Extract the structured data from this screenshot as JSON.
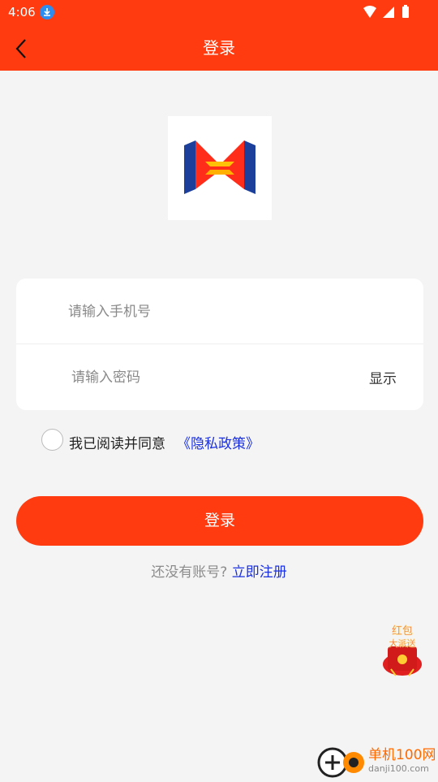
{
  "status": {
    "time": "4:06"
  },
  "header": {
    "title": "登录"
  },
  "form": {
    "phone_placeholder": "请输入手机号",
    "password_placeholder": "请输入密码",
    "show_label": "显示"
  },
  "agreement": {
    "text": "我已阅读并同意",
    "link": "《隐私政策》"
  },
  "login_button": "登录",
  "register": {
    "prompt": "还没有账号?",
    "link": "立即注册"
  },
  "promo": {
    "line1": "红包",
    "line2": "大派送"
  },
  "watermark": {
    "title": "单机100网",
    "url": "danji100.com"
  },
  "colors": {
    "primary": "#ff3b0f",
    "link": "#1a2fe0",
    "background": "#f4f4f4"
  }
}
